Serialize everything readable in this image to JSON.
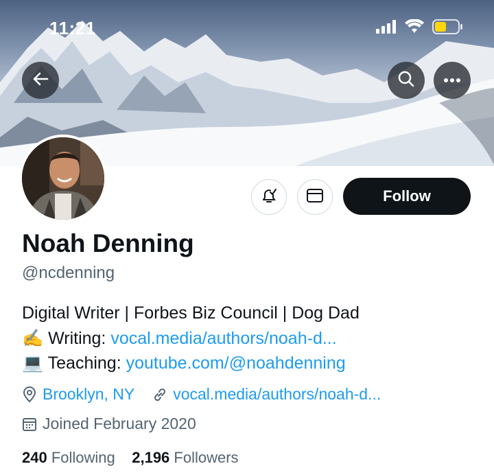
{
  "status_bar": {
    "time": "11:21"
  },
  "profile": {
    "name": "Noah Denning",
    "handle": "@ncdenning",
    "bio_line1": "Digital Writer | Forbes Biz Council | Dog Dad",
    "bio_line2_emoji": "✍️",
    "bio_line2_label": "Writing: ",
    "bio_line2_link": "vocal.media/authors/noah-d...",
    "bio_line3_emoji": "💻",
    "bio_line3_label": "Teaching: ",
    "bio_line3_link": "youtube.com/@noahdenning",
    "location": "Brooklyn, NY",
    "website": "vocal.media/authors/noah-d...",
    "joined": "Joined February 2020",
    "following_count": "240",
    "following_label": "Following",
    "followers_count": "2,196",
    "followers_label": "Followers"
  },
  "actions": {
    "follow_label": "Follow"
  },
  "icons": [
    "back-arrow-icon",
    "search-icon",
    "more-icon",
    "notify-bell-icon",
    "mail-icon",
    "location-pin-icon",
    "link-icon",
    "calendar-icon",
    "signal-icon",
    "wifi-icon",
    "battery-icon"
  ],
  "colors": {
    "link": "#1d9bf0",
    "text": "#0f1419",
    "muted": "#536471",
    "follow_bg": "#0f1419"
  }
}
